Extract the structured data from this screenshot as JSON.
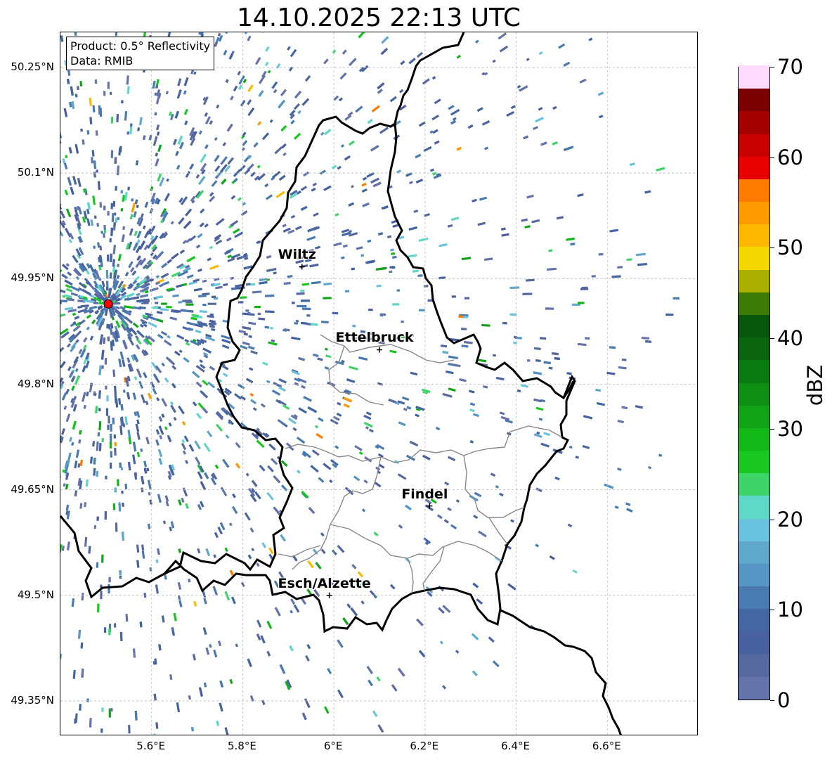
{
  "title": "14.10.2025 22:13 UTC",
  "infobox": {
    "product": "Product: 0.5° Reflectivity",
    "data": "Data: RMIB"
  },
  "map": {
    "lon_range": [
      5.4,
      6.8
    ],
    "lat_range": [
      49.3,
      50.3
    ],
    "lat_ticks": [
      {
        "value": 50.25,
        "label": "50.25°N"
      },
      {
        "value": 50.1,
        "label": "50.1°N"
      },
      {
        "value": 49.95,
        "label": "49.95°N"
      },
      {
        "value": 49.8,
        "label": "49.8°N"
      },
      {
        "value": 49.65,
        "label": "49.65°N"
      },
      {
        "value": 49.5,
        "label": "49.5°N"
      },
      {
        "value": 49.35,
        "label": "49.35°N"
      }
    ],
    "lon_ticks": [
      {
        "value": 5.6,
        "label": "5.6°E"
      },
      {
        "value": 5.8,
        "label": "5.8°E"
      },
      {
        "value": 6.0,
        "label": "6°E"
      },
      {
        "value": 6.2,
        "label": "6.2°E"
      },
      {
        "value": 6.4,
        "label": "6.4°E"
      },
      {
        "value": 6.6,
        "label": "6.6°E"
      }
    ],
    "radar_site": {
      "lon": 5.505,
      "lat": 49.914,
      "color": "#ff0000"
    },
    "cities": [
      {
        "name": "Wiltz",
        "lon": 5.93,
        "lat": 49.967
      },
      {
        "name": "Ettelbruck",
        "lon": 6.1,
        "lat": 49.849
      },
      {
        "name": "Findel",
        "lon": 6.21,
        "lat": 49.627
      },
      {
        "name": "Esch/Alzette",
        "lon": 5.99,
        "lat": 49.5
      }
    ]
  },
  "colorbar": {
    "label": "dBZ",
    "min": 0,
    "max": 70,
    "step": 2.5,
    "ticks": [
      {
        "value": 0,
        "label": "0"
      },
      {
        "value": 10,
        "label": "10"
      },
      {
        "value": 20,
        "label": "20"
      },
      {
        "value": 30,
        "label": "30"
      },
      {
        "value": 40,
        "label": "40"
      },
      {
        "value": 50,
        "label": "50"
      },
      {
        "value": 60,
        "label": "60"
      },
      {
        "value": 70,
        "label": "70"
      }
    ],
    "colors": [
      "#6473a9",
      "#56699f",
      "#4a61a0",
      "#4466a2",
      "#4a7bb0",
      "#5596c4",
      "#5fa8cc",
      "#69c3de",
      "#5fd8c8",
      "#3fd46a",
      "#18c820",
      "#12b818",
      "#12a418",
      "#0f9015",
      "#0c7a12",
      "#0a6410",
      "#08560e",
      "#3e7a08",
      "#aab000",
      "#f5d800",
      "#ffb800",
      "#ff9a00",
      "#ff7b00",
      "#e80000",
      "#c80000",
      "#a40000",
      "#7d0000",
      "#ffdcff",
      "#ffb4ff",
      "#ff6eff",
      "#ea37ea",
      "#ea37ea"
    ],
    "colors_note": ""
  }
}
